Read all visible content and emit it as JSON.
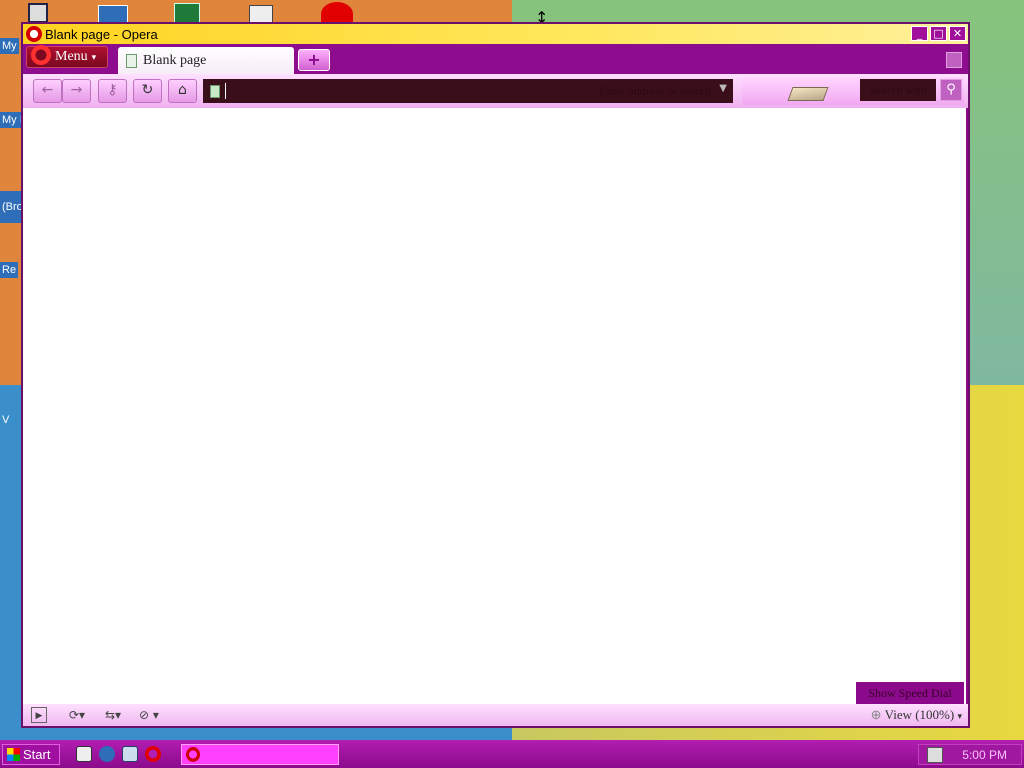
{
  "window": {
    "title": "Blank page - Opera",
    "controls": {
      "minimize": "_",
      "maximize": "□",
      "close": "✕"
    }
  },
  "desktop": {
    "labels": [
      "My",
      "My I",
      "(Bro",
      "Re",
      "V"
    ]
  },
  "tabbar": {
    "menu_label": "Menu",
    "tabs": [
      {
        "label": "Blank page",
        "icon": "page-icon",
        "active": true
      }
    ],
    "new_tab": "+"
  },
  "toolbar": {
    "buttons": [
      "back-icon",
      "forward-icon",
      "key-icon",
      "reload-icon",
      "home-icon"
    ],
    "address": {
      "value": "",
      "placeholder": "Enter address or search"
    },
    "search": {
      "placeholder": "Search with",
      "button_icon": "magnifier-icon"
    }
  },
  "content": {
    "speed_dial_label": "Show Speed Dial"
  },
  "statusbar": {
    "zoom_label": "View (100%)"
  },
  "taskbar": {
    "start_label": "Start",
    "clock": "5:00 PM"
  },
  "colors": {
    "chrome": "#8b0a8b",
    "titlebar": "#ffd21f",
    "toolbar": "#f0b0f0",
    "address_bg": "#3a0f1a",
    "taskbar": "#b21eb2"
  }
}
